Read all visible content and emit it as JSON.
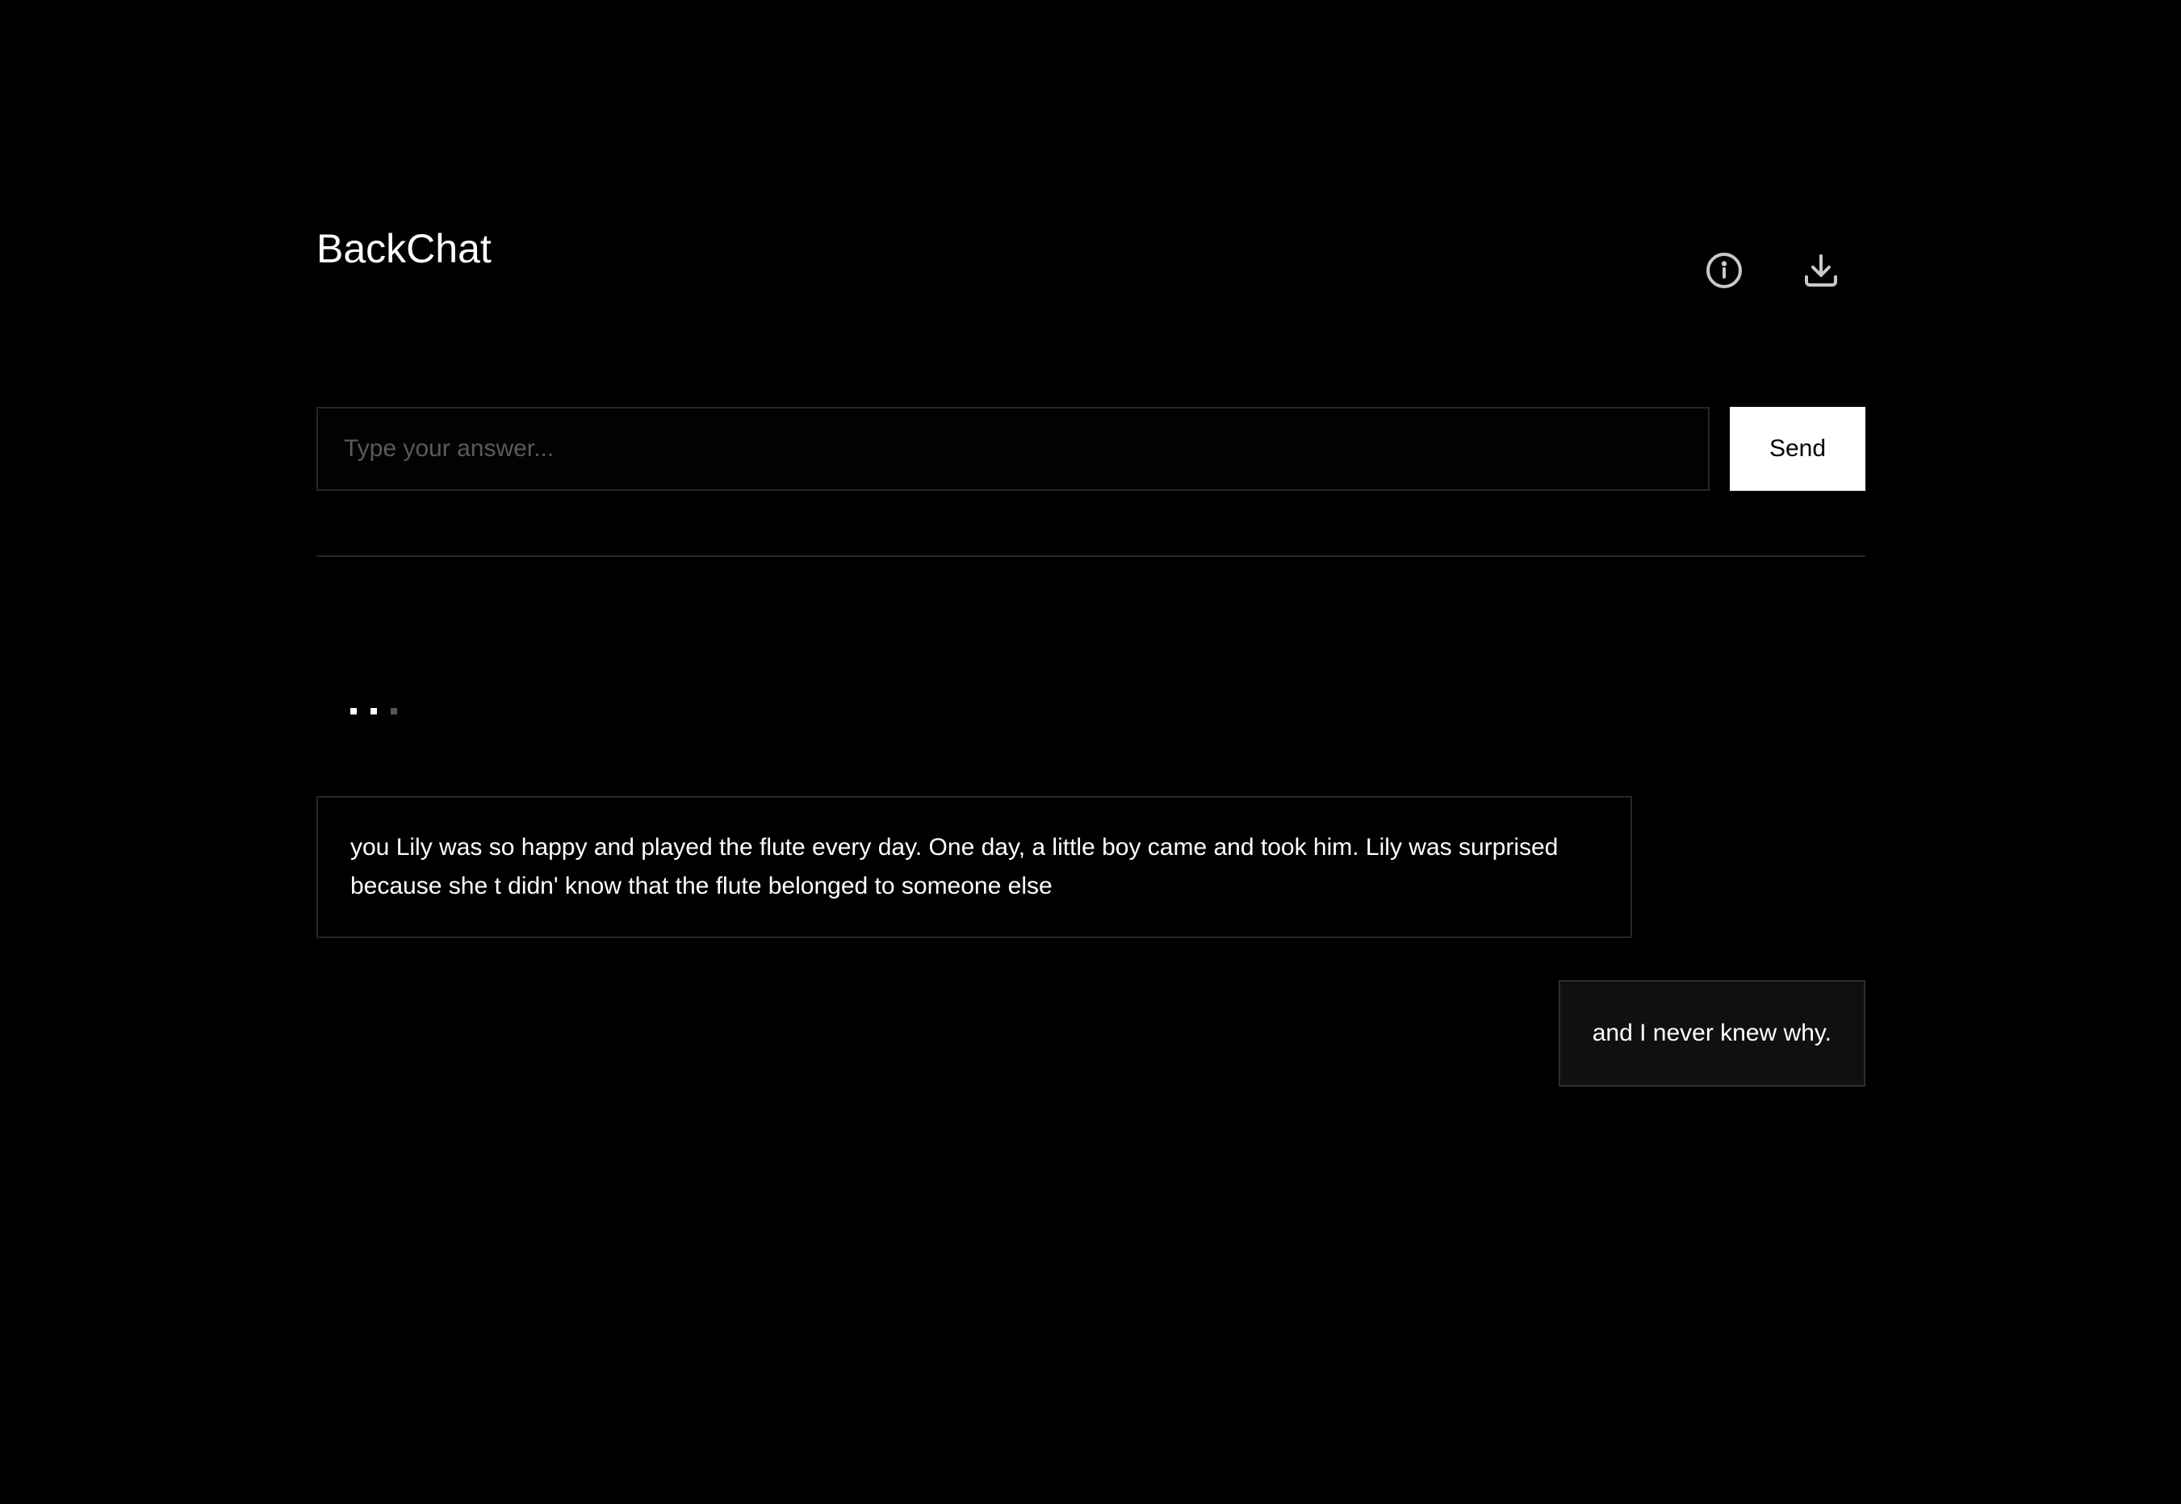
{
  "app": {
    "title": "BackChat"
  },
  "header": {
    "info_icon": "info-circle-icon",
    "download_icon": "download-icon"
  },
  "composer": {
    "placeholder": "Type your answer...",
    "value": "",
    "send_label": "Send"
  },
  "conversation": {
    "typing_indicator": "typing-dots",
    "messages": [
      {
        "role": "bot",
        "text": "you Lily was so happy and played the flute every day. One day, a little boy came and took him. Lily was surprised because she t didn' know that the flute belonged to someone else"
      },
      {
        "role": "user",
        "text": "and I never knew why."
      }
    ]
  },
  "colors": {
    "background": "#000000",
    "text": "#ffffff",
    "border": "#262626",
    "send_button_bg": "#ffffff",
    "send_button_text": "#000000",
    "user_bubble_bg": "#101010",
    "placeholder": "#5a5a5a"
  }
}
